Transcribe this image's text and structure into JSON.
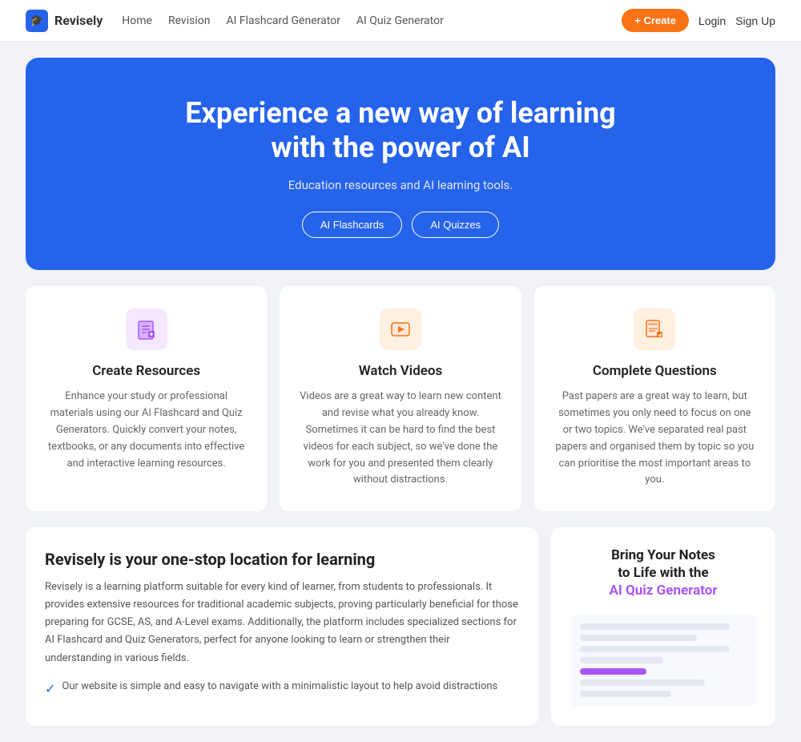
{
  "brand": {
    "name": "Revisely",
    "icon": "🎓"
  },
  "nav": {
    "links": [
      "Home",
      "Revision",
      "AI Flashcard Generator",
      "AI Quiz Generator"
    ],
    "create_label": "+ Create",
    "login_label": "Login",
    "signup_label": "Sign Up"
  },
  "hero": {
    "title": "Experience a new way of learning\nwith the power of AI",
    "subtitle": "Education resources and AI learning tools.",
    "btn_flashcards": "AI Flashcards",
    "btn_quizzes": "AI Quizzes"
  },
  "features": [
    {
      "title": "Create Resources",
      "icon": "📝",
      "icon_class": "icon-create",
      "text": "Enhance your study or professional materials using our AI Flashcard and Quiz Generators. Quickly convert your notes, textbooks, or any documents into effective and interactive learning resources."
    },
    {
      "title": "Watch Videos",
      "icon": "▶️",
      "icon_class": "icon-video",
      "text": "Videos are a great way to learn new content and revise what you already know. Sometimes it can be hard to find the best videos for each subject, so we've done the work for you and presented them clearly without distractions."
    },
    {
      "title": "Complete Questions",
      "icon": "📋",
      "icon_class": "icon-questions",
      "text": "Past papers are a great way to learn, but sometimes you only need to focus on one or two topics. We've separated real past papers and organised them by topic so you can prioritise the most important areas to you."
    }
  ],
  "learning": {
    "title": "Revisely is your one-stop location for learning",
    "text": "Revisely is a learning platform suitable for every kind of learner, from students to professionals. It provides extensive resources for traditional academic subjects, proving particularly beneficial for those preparing for GCSE, AS, and A-Level exams. Additionally, the platform includes specialized sections for AI Flashcard and Quiz Generators, perfect for anyone looking to learn or strengthen their understanding in various fields.",
    "check_item": "Our website is simple and easy to navigate with a minimalistic layout to help avoid distractions"
  },
  "quiz_promo": {
    "title_line1": "Bring Your Notes",
    "title_line2": "to Life with the",
    "title_highlight": "AI Quiz Generator"
  }
}
